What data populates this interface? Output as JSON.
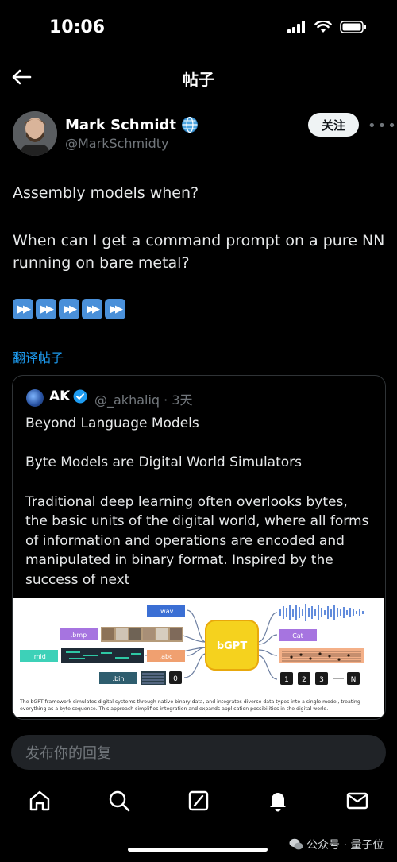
{
  "status_bar": {
    "time": "10:06"
  },
  "header": {
    "title": "帖子"
  },
  "post": {
    "author_name": "Mark Schmidt",
    "author_handle": "@MarkSchmidty",
    "follow_label": "关注",
    "more_label": "•••",
    "text_line1": "Assembly models when?",
    "text_line2": "When can I get a command prompt on a pure NN",
    "text_line3": "running on bare metal?",
    "emojis": [
      "fast-forward",
      "fast-forward",
      "fast-forward",
      "fast-forward",
      "fast-forward"
    ],
    "translate_label": "翻译帖子"
  },
  "quote": {
    "name": "AK",
    "handle": "@_akhaliq · 3天",
    "line1": "Beyond Language Models",
    "line2": "Byte Models are Digital World Simulators",
    "body1": "Traditional deep learning often overlooks bytes,",
    "body2": "the basic units of the digital world, where all forms",
    "body3": "of information and operations are encoded and",
    "body4": "manipulated in binary format. Inspired by the",
    "body5": "success of next",
    "figure": {
      "center_label": "bGPT",
      "wav": ".wav",
      "bmp": ".bmp",
      "mid": ".mid",
      "abc": ".abc",
      "bin": ".bin",
      "cat": "Cat",
      "zero": "0",
      "n1": "1",
      "n2": "2",
      "n3": "3",
      "nN": "N",
      "caption1": "The bGPT framework simulates digital systems through native binary data, and integrates diverse data types into a single model, treating",
      "caption2": "everything as a byte sequence. This approach simplifies integration and expands application possibilities in the digital world."
    }
  },
  "reply": {
    "placeholder": "发布你的回复"
  },
  "tabs": [
    "home-icon",
    "search-icon",
    "grok-icon",
    "notifications-icon",
    "messages-icon"
  ],
  "watermark": "公众号 · 量子位",
  "colors": {
    "accent": "#1d9bf0",
    "background": "#000000"
  }
}
